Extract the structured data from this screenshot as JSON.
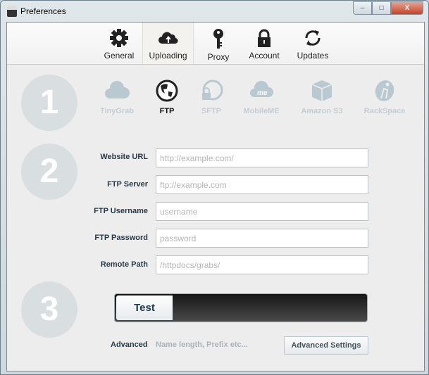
{
  "window": {
    "title": "Preferences",
    "minimize": "–",
    "maximize": "□",
    "close": "X"
  },
  "tabs": [
    {
      "label": "General",
      "icon": "gear-icon"
    },
    {
      "label": "Uploading",
      "icon": "cloud-upload-icon",
      "selected": true
    },
    {
      "label": "Proxy",
      "icon": "key-icon"
    },
    {
      "label": "Account",
      "icon": "lock-icon"
    },
    {
      "label": "Updates",
      "icon": "refresh-icon"
    }
  ],
  "steps": [
    "1",
    "2",
    "3"
  ],
  "services": [
    {
      "label": "TinyGrab"
    },
    {
      "label": "FTP",
      "selected": true
    },
    {
      "label": "SFTP"
    },
    {
      "label": "MobileME"
    },
    {
      "label": "Amazon S3"
    },
    {
      "label": "RackSpace"
    }
  ],
  "fields": [
    {
      "label": "Website URL",
      "placeholder": "http://example.com/"
    },
    {
      "label": "FTP Server",
      "placeholder": "ftp://example.com"
    },
    {
      "label": "FTP Username",
      "placeholder": "username"
    },
    {
      "label": "FTP Password",
      "placeholder": "password"
    },
    {
      "label": "Remote Path",
      "placeholder": "/httpdocs/grabs/"
    }
  ],
  "test": {
    "label": "Test"
  },
  "advanced": {
    "label": "Advanced",
    "hint": "Name length, Prefix etc...",
    "button": "Advanced Settings"
  }
}
